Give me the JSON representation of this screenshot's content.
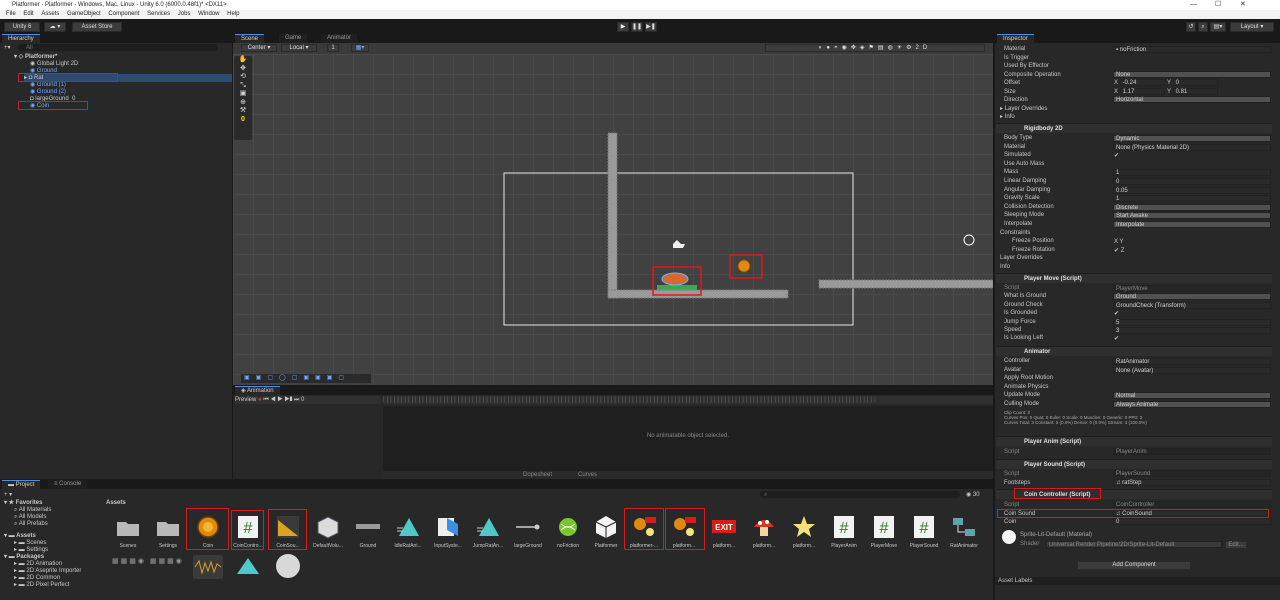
{
  "window": {
    "title": "Platformer - Platformer - Windows, Mac, Linux - Unity 6.0 (6000.0.48f1)* <DX11>"
  },
  "menu": [
    "File",
    "Edit",
    "Assets",
    "GameObject",
    "Component",
    "Services",
    "Jobs",
    "Window",
    "Help"
  ],
  "toolbar": {
    "account": "Unity 6",
    "asset_store": "Asset Store",
    "layout": "Layout"
  },
  "hierarchy": {
    "tab": "Hierarchy",
    "search_placeholder": "All",
    "scene": "Platformer*",
    "items": [
      "Global Light 2D",
      "Ground",
      "Rat",
      "Ground (1)",
      "Ground (2)",
      "largeGround_0",
      "Coin"
    ]
  },
  "scene": {
    "tabs": [
      "Scene",
      "Game",
      "Animator"
    ],
    "pivot": "Center",
    "space": "Local",
    "snap": "1",
    "coin_count": "0"
  },
  "animation": {
    "tab": "Animation",
    "preview": "Preview",
    "frame": "0",
    "message": "No animatable object selected.",
    "dopesheet": "Dopesheet",
    "curves": "Curves"
  },
  "inspector": {
    "tab": "Inspector",
    "top_rows": [
      [
        "Material",
        "noFriction"
      ],
      [
        "Is Trigger",
        ""
      ],
      [
        "Used By Effector",
        ""
      ],
      [
        "Composite Operation",
        "None"
      ],
      [
        "Offset",
        ""
      ],
      [
        "Size",
        ""
      ],
      [
        "Direction",
        "Horizontal"
      ],
      [
        "Layer Overrides",
        ""
      ],
      [
        "Info",
        ""
      ]
    ],
    "offset": {
      "x": "-0.24",
      "y": "0"
    },
    "size": {
      "x": "1.17",
      "y": "0.81"
    },
    "rigidbody": {
      "title": "Rigidbody 2D",
      "rows": [
        [
          "Body Type",
          "Dynamic"
        ],
        [
          "Material",
          "None (Physics Material 2D)"
        ],
        [
          "Simulated",
          "✔"
        ],
        [
          "Use Auto Mass",
          ""
        ],
        [
          "Mass",
          "1"
        ],
        [
          "Linear Damping",
          "0"
        ],
        [
          "Angular Damping",
          "0.05"
        ],
        [
          "Gravity Scale",
          "1"
        ],
        [
          "Collision Detection",
          "Discrete"
        ],
        [
          "Sleeping Mode",
          "Start Awake"
        ],
        [
          "Interpolate",
          "Interpolate"
        ],
        [
          "Constraints",
          ""
        ],
        [
          "Freeze Position",
          "X   Y"
        ],
        [
          "Freeze Rotation",
          "✔ Z"
        ],
        [
          "Layer Overrides",
          ""
        ],
        [
          "Info",
          ""
        ]
      ]
    },
    "player_move": {
      "title": "Player Move (Script)",
      "rows": [
        [
          "Script",
          "PlayerMove"
        ],
        [
          "What Is Ground",
          "Ground"
        ],
        [
          "Ground Check",
          "GroundCheck (Transform)"
        ],
        [
          "Is Grounded",
          "✔"
        ],
        [
          "Jump Force",
          "5"
        ],
        [
          "Speed",
          "3"
        ],
        [
          "Is Looking Left",
          "✔"
        ]
      ]
    },
    "animator": {
      "title": "Animator",
      "rows": [
        [
          "Controller",
          "RatAnimator"
        ],
        [
          "Avatar",
          "None (Avatar)"
        ],
        [
          "Apply Root Motion",
          ""
        ],
        [
          "Animate Physics",
          ""
        ],
        [
          "Update Mode",
          "Normal"
        ],
        [
          "Culling Mode",
          "Always Animate"
        ]
      ],
      "clip_info": [
        "Clip Count: 3",
        "Curves Pos: 0 Quat: 0 Euler: 0 Scale: 0 Muscles: 0 Generic: 0 PPtr: 3",
        "Curves Total: 3 Constant: 0 (0.0%) Dense: 0 (0.0%) Stream: 3 (100.0%)"
      ]
    },
    "player_anim": {
      "title": "Player Anim (Script)",
      "script": "PlayerAnim"
    },
    "player_sound": {
      "title": "Player Sound (Script)",
      "script": "PlayerSound",
      "footsteps": "ratStep"
    },
    "coin_controller": {
      "title": "Coin Controller (Script)",
      "script": "CoinController",
      "coin_sound": "CoinSound",
      "coin": "0"
    },
    "material": {
      "name": "Sprite-Lit-Default (Material)",
      "shader_label": "Shader",
      "shader": "Universal Render Pipeline/2D/Sprite-Lit-Default",
      "edit": "Edit..."
    },
    "add_component": "Add Component",
    "asset_labels": "Asset Labels"
  },
  "project": {
    "tabs": [
      "Project",
      "Console"
    ],
    "favorites": "Favorites",
    "fav_items": [
      "All Materials",
      "All Models",
      "All Prefabs"
    ],
    "assets": "Assets",
    "asset_folders": [
      "Scenes",
      "Settings"
    ],
    "packages": "Packages",
    "package_items": [
      "2D Animation",
      "2D Aseprite Importer",
      "2D Common",
      "2D Pixel Perfect"
    ],
    "breadcrumb": "Assets",
    "zoom": "30"
  },
  "asset_grid": [
    "Scenes",
    "Settings",
    "Coin",
    "CoinContro...",
    "CoinSou...",
    "DefaultVolu...",
    "Ground",
    "IdleRatAni...",
    "InputSyste...",
    "JumpRatAn...",
    "largeGround",
    "noFriction",
    "Platformer",
    "platformer-...",
    "platform...",
    "platform...",
    "platform...",
    "platform...",
    "PlayerAnim",
    "PlayerMove",
    "PlayerSound",
    "RatAnimator"
  ]
}
